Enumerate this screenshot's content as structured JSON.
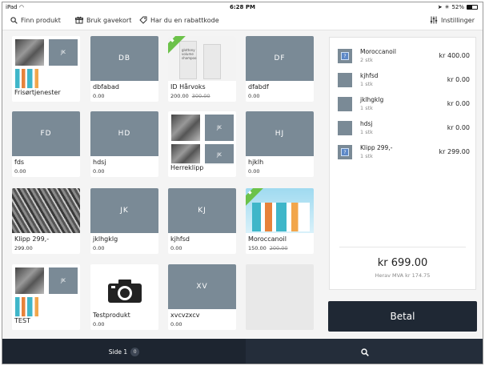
{
  "statusbar": {
    "device": "iPad",
    "time": "6:28 PM",
    "battery": "52%"
  },
  "toolbar": {
    "find_product": "Finn produkt",
    "use_giftcard": "Bruk gavekort",
    "discount_code": "Har du en rabattkode",
    "settings": "Instillinger"
  },
  "tiles": [
    {
      "name": "Frisørtjenester",
      "initials": "JK"
    },
    {
      "name": "dbfabad",
      "initials": "DB",
      "price": "0.00"
    },
    {
      "name": "ID Hårvoks",
      "price": "200.00",
      "old_price": "300.00"
    },
    {
      "name": "dfabdf",
      "initials": "DF",
      "price": "0.00"
    },
    {
      "name": "fds",
      "initials": "FD",
      "price": "0.00"
    },
    {
      "name": "hdsj",
      "initials": "HD",
      "price": "0.00"
    },
    {
      "name": "Herreklipp",
      "initials": "JK"
    },
    {
      "name": "hjklh",
      "initials": "HJ",
      "price": "0.00"
    },
    {
      "name": "Klipp 299,-",
      "price": "299.00"
    },
    {
      "name": "jklhgklg",
      "initials": "JK",
      "price": "0.00"
    },
    {
      "name": "kjhfsd",
      "initials": "KJ",
      "price": "0.00"
    },
    {
      "name": "Moroccanoil",
      "price": "150.00",
      "old_price": "200.00"
    },
    {
      "name": "TEST",
      "initials": "JK"
    },
    {
      "name": "Testprodukt",
      "price": "0.00"
    },
    {
      "name": "xvcvzxcv",
      "initials": "XV",
      "price": "0.00"
    }
  ],
  "product_image_text": {
    "tube_brand": "glottony",
    "tube_desc": "volume shampoo"
  },
  "cart": {
    "lines": [
      {
        "name": "Moroccanoil",
        "qty": "2 stk",
        "price": "kr 400.00",
        "thumb": "question-icon"
      },
      {
        "name": "kjhfsd",
        "qty": "1 stk",
        "price": "kr 0.00",
        "thumb": "color-swatch"
      },
      {
        "name": "jklhgklg",
        "qty": "1 stk",
        "price": "kr 0.00",
        "thumb": "color-swatch"
      },
      {
        "name": "hdsj",
        "qty": "1 stk",
        "price": "kr 0.00",
        "thumb": "color-swatch"
      },
      {
        "name": "Klipp 299,-",
        "qty": "1 stk",
        "price": "kr 299.00",
        "thumb": "question-icon"
      }
    ],
    "total": "kr 699.00",
    "vat": "Herav MVA kr 174.75"
  },
  "pay_label": "Betal",
  "bottom": {
    "page_label": "Side 1",
    "page_count": "0"
  },
  "colors": {
    "swatch": "#7a8a96",
    "pay_button": "#1f2834",
    "bottom_bar": "#171e27",
    "sale_ribbon": "#6cc24a"
  }
}
